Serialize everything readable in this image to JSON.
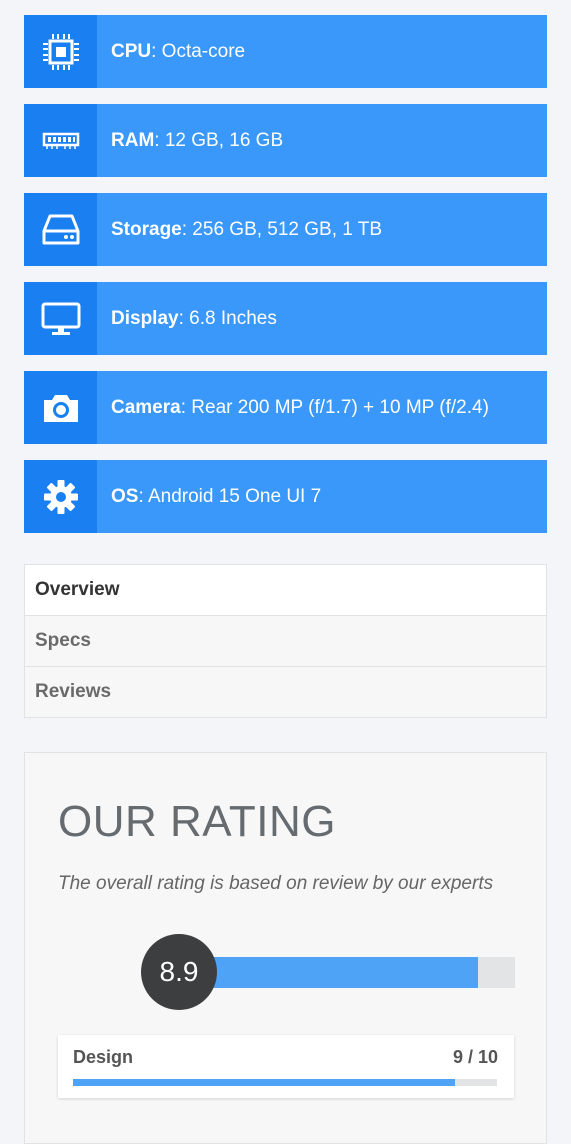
{
  "specs": [
    {
      "icon": "cpu-icon",
      "label": "CPU",
      "value": ": Octa-core"
    },
    {
      "icon": "ram-icon",
      "label": "RAM",
      "value": ": 12 GB, 16 GB"
    },
    {
      "icon": "storage-icon",
      "label": "Storage",
      "value": ": 256 GB, 512 GB, 1 TB"
    },
    {
      "icon": "display-icon",
      "label": "Display",
      "value": ": 6.8 Inches"
    },
    {
      "icon": "camera-icon",
      "label": "Camera",
      "value": ": Rear 200 MP (f/1.7) + 10 MP (f/2.4)"
    },
    {
      "icon": "gear-icon",
      "label": "OS",
      "value": ": Android 15 One UI 7"
    }
  ],
  "tabs": [
    {
      "label": "Overview",
      "active": true
    },
    {
      "label": "Specs",
      "active": false
    },
    {
      "label": "Reviews",
      "active": false
    }
  ],
  "rating": {
    "title": "OUR RATING",
    "subtitle": "The overall rating is based on review by our experts",
    "overall": "8.9",
    "overall_fraction": 0.89,
    "items": [
      {
        "label": "Design",
        "score": "9 / 10",
        "fraction": 0.9
      }
    ]
  },
  "colors": {
    "spec_bg": "#3a98fb",
    "spec_icon_bg": "#1a7ff0",
    "bar_fill": "#4ea3f7",
    "score_circle": "#3d3e40"
  }
}
